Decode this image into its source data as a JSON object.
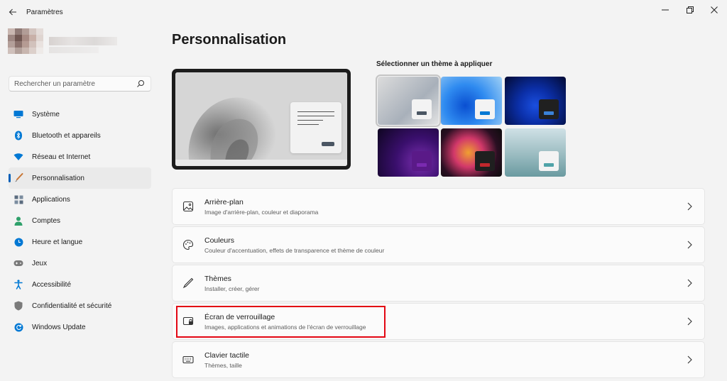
{
  "window": {
    "title": "Paramètres",
    "back_icon": "arrow-left-icon",
    "controls": [
      "minimize-icon",
      "restore-icon",
      "close-icon"
    ]
  },
  "search": {
    "placeholder": "Rechercher un paramètre"
  },
  "sidebar": {
    "items": [
      {
        "label": "Système",
        "icon": "monitor-icon",
        "color": "#0078d4"
      },
      {
        "label": "Bluetooth et appareils",
        "icon": "bluetooth-icon",
        "color": "#0078d4"
      },
      {
        "label": "Réseau et Internet",
        "icon": "wifi-icon",
        "color": "#0078d4"
      },
      {
        "label": "Personnalisation",
        "icon": "brush-icon",
        "color": "#c87533",
        "active": true
      },
      {
        "label": "Applications",
        "icon": "apps-icon",
        "color": "#5b6c7f"
      },
      {
        "label": "Comptes",
        "icon": "person-icon",
        "color": "#2fa16b"
      },
      {
        "label": "Heure et langue",
        "icon": "globe-clock-icon",
        "color": "#0078d4"
      },
      {
        "label": "Jeux",
        "icon": "gamepad-icon",
        "color": "#6b6b6b"
      },
      {
        "label": "Accessibilité",
        "icon": "accessibility-icon",
        "color": "#0078d4"
      },
      {
        "label": "Confidentialité et sécurité",
        "icon": "shield-icon",
        "color": "#6b6b6b"
      },
      {
        "label": "Windows Update",
        "icon": "update-icon",
        "color": "#0078d4"
      }
    ]
  },
  "main": {
    "title": "Personnalisation",
    "themes_title": "Sélectionner un thème à appliquer",
    "cards": [
      {
        "title": "Arrière-plan",
        "subtitle": "Image d'arrière-plan, couleur et diaporama",
        "icon": "image-icon"
      },
      {
        "title": "Couleurs",
        "subtitle": "Couleur d'accentuation, effets de transparence et thème de couleur",
        "icon": "palette-icon"
      },
      {
        "title": "Thèmes",
        "subtitle": "Installer, créer, gérer",
        "icon": "pen-icon"
      },
      {
        "title": "Écran de verrouillage",
        "subtitle": "Images, applications et animations de l'écran de verrouillage",
        "icon": "lock-screen-icon"
      },
      {
        "title": "Clavier tactile",
        "subtitle": "Thèmes, taille",
        "icon": "keyboard-icon"
      }
    ]
  },
  "colors": {
    "accent": "#005fb8",
    "highlight": "#e30613"
  }
}
